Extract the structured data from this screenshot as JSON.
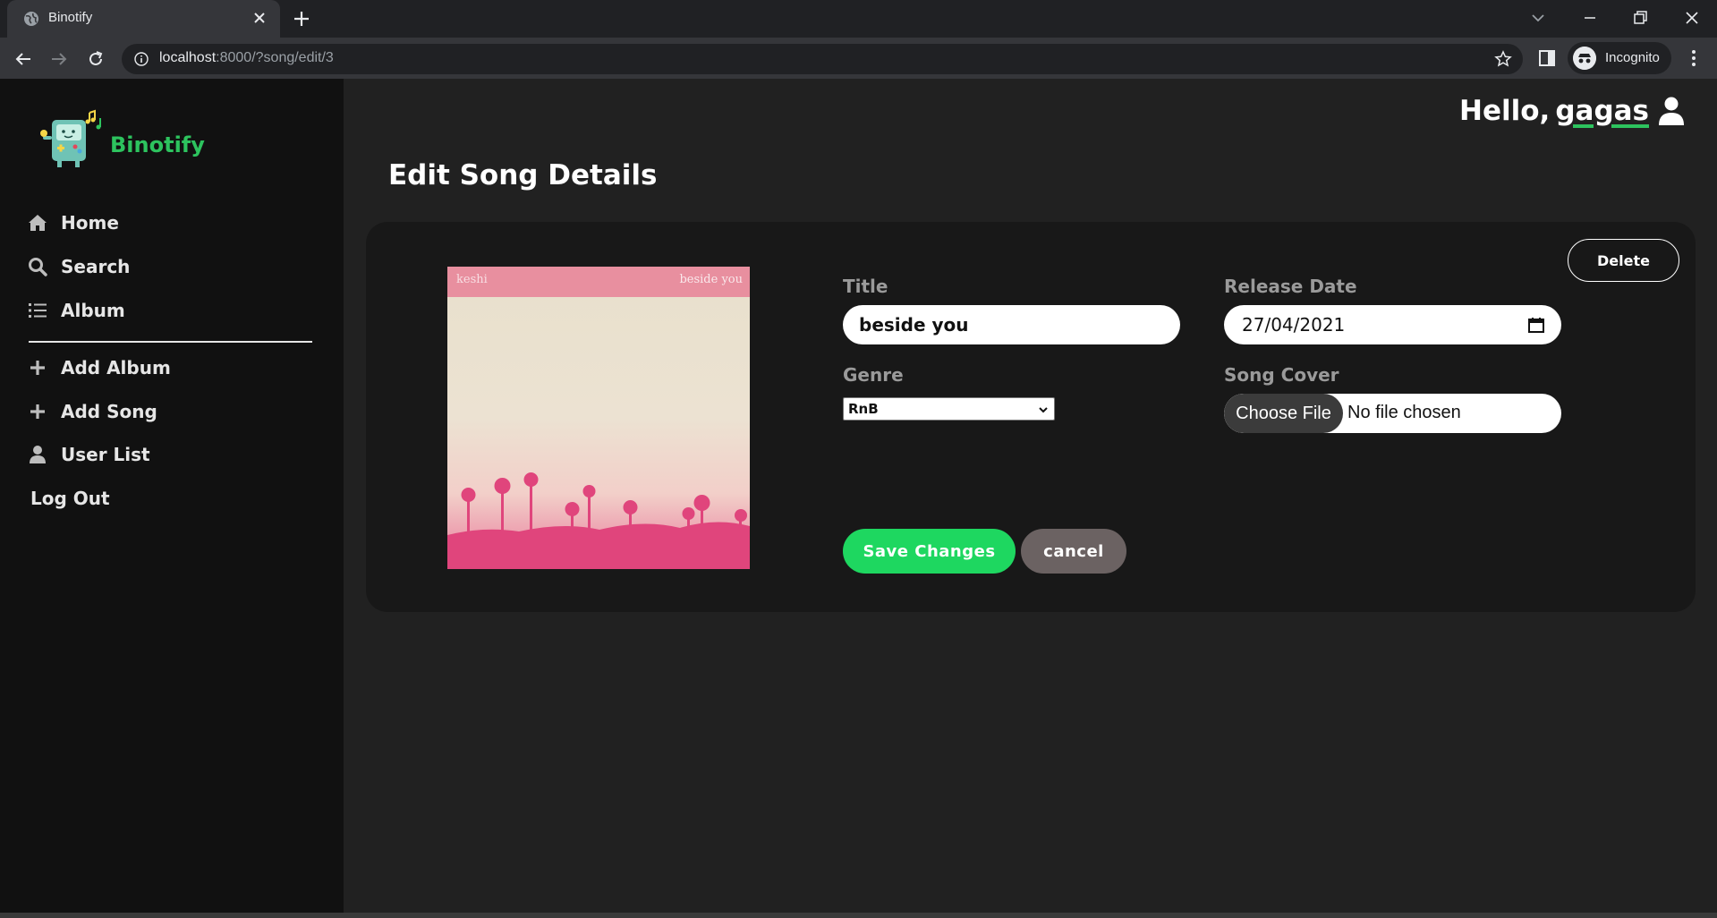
{
  "browser": {
    "tab_title": "Binotify",
    "url_host": "localhost",
    "url_rest": ":8000/?song/edit/3",
    "profile_label": "Incognito"
  },
  "icons": {
    "favicon": "globe-icon",
    "tab_close": "close-icon",
    "new_tab": "plus-icon",
    "back": "back-arrow-icon",
    "forward": "forward-arrow-icon",
    "reload": "reload-icon",
    "site_info": "info-icon",
    "bookmark": "star-icon",
    "side_panel": "side-panel-icon",
    "incognito": "incognito-icon",
    "menu": "kebab-menu-icon",
    "user": "user-icon",
    "calendar": "calendar-icon",
    "select_arrow": "chevron-down-icon"
  },
  "app": {
    "brand": "Binotify",
    "accent_color": "#2dc35e"
  },
  "sidebar": {
    "primary": [
      {
        "label": "Home",
        "icon": "home-icon"
      },
      {
        "label": "Search",
        "icon": "search-icon"
      },
      {
        "label": "Album",
        "icon": "list-icon"
      }
    ],
    "secondary": [
      {
        "label": "Add Album",
        "icon": "plus-icon"
      },
      {
        "label": "Add Song",
        "icon": "plus-icon"
      },
      {
        "label": "User List",
        "icon": "user-icon"
      }
    ],
    "logout": "Log Out"
  },
  "header": {
    "greeting": "Hello,",
    "username": "gagas"
  },
  "main": {
    "page_title": "Edit Song Details",
    "delete_label": "Delete",
    "cover": {
      "artist": "keshi",
      "title": "beside you"
    },
    "form": {
      "title_label": "Title",
      "title_value": "beside you",
      "release_label": "Release Date",
      "release_value": "27/04/2021",
      "genre_label": "Genre",
      "genre_value": "RnB",
      "cover_label": "Song Cover",
      "file_button": "Choose File",
      "file_status": "No file chosen"
    },
    "save_label": "Save Changes",
    "cancel_label": "cancel",
    "colors": {
      "save": "#1ed760",
      "cancel": "#6b6262"
    }
  }
}
